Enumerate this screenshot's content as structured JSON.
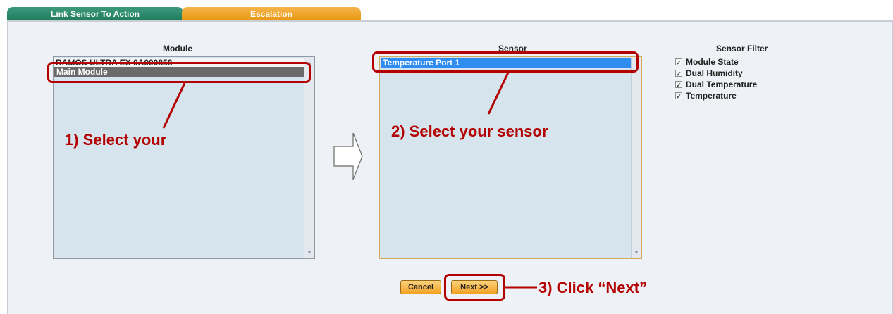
{
  "tabs": [
    {
      "label": "Link Sensor To Action"
    },
    {
      "label": "Escalation"
    }
  ],
  "module_panel": {
    "heading": "Module",
    "items": [
      "RAMOS ULTRA EX 0A000858",
      "Main Module"
    ],
    "selected_index": 1
  },
  "sensor_panel": {
    "heading": "Sensor",
    "items": [
      "Temperature Port 1"
    ],
    "selected_index": 0
  },
  "sensor_filter": {
    "heading": "Sensor Filter",
    "items": [
      {
        "label": "Module State",
        "checked": true
      },
      {
        "label": "Dual Humidity",
        "checked": true
      },
      {
        "label": "Dual Temperature",
        "checked": true
      },
      {
        "label": "Temperature",
        "checked": true
      }
    ]
  },
  "buttons": {
    "cancel": "Cancel",
    "next": "Next >>"
  },
  "annotations": {
    "step1": "1) Select your",
    "step2": "2) Select your sensor",
    "step3": "3) Click “Next”"
  },
  "colors": {
    "tab_active": "#2a8a6a",
    "tab_secondary": "#f0a52a",
    "callout": "#b30000",
    "selection_blue": "#2f8cf0",
    "selection_grey": "#6b6b6b"
  }
}
